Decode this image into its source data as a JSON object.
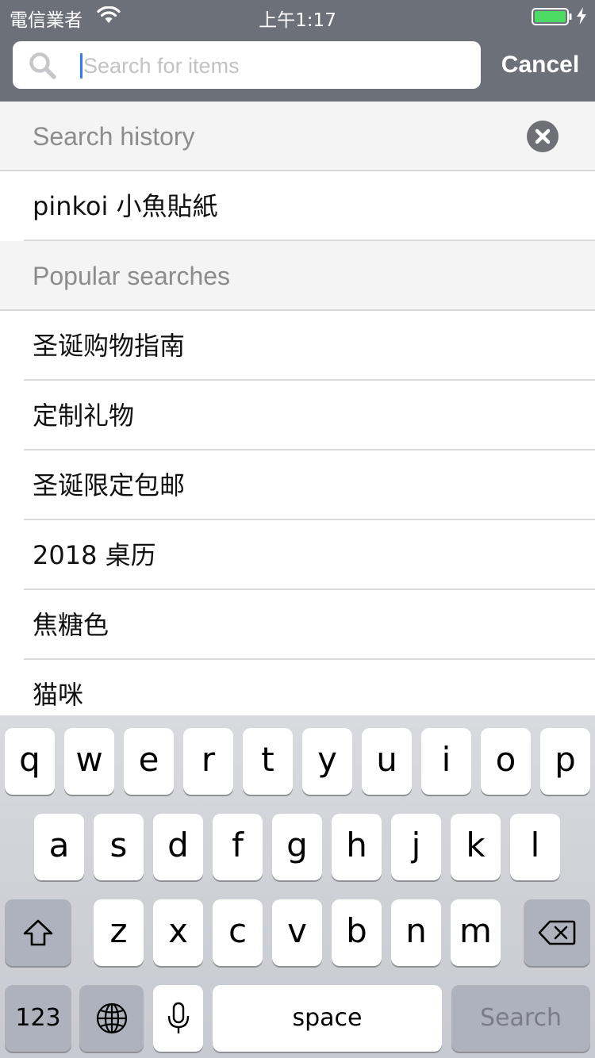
{
  "status_bar": {
    "carrier": "電信業者",
    "time": "上午1:17",
    "icons": [
      "wifi-icon",
      "battery-icon",
      "charging-bolt-icon"
    ],
    "battery_color": "#4cd964"
  },
  "search": {
    "placeholder": "Search for items",
    "value": "",
    "cancel_label": "Cancel",
    "icon": "magnifier-icon"
  },
  "history": {
    "header": "Search history",
    "clear_icon": "clear-x-circle-icon",
    "items": [
      {
        "label": "pinkoi 小魚貼紙"
      }
    ]
  },
  "popular": {
    "header": "Popular searches",
    "items": [
      {
        "label": "圣诞购物指南"
      },
      {
        "label": "定制礼物"
      },
      {
        "label": "圣诞限定包邮"
      },
      {
        "label": "2018 桌历"
      },
      {
        "label": "焦糖色"
      },
      {
        "label": "猫咪"
      }
    ]
  },
  "keyboard": {
    "row1": [
      "q",
      "w",
      "e",
      "r",
      "t",
      "y",
      "u",
      "i",
      "o",
      "p"
    ],
    "row2": [
      "a",
      "s",
      "d",
      "f",
      "g",
      "h",
      "j",
      "k",
      "l"
    ],
    "row3": [
      "z",
      "x",
      "c",
      "v",
      "b",
      "n",
      "m"
    ],
    "numbers_label": "123",
    "space_label": "space",
    "search_label": "Search",
    "icons": [
      "shift-icon",
      "backspace-icon",
      "globe-icon",
      "microphone-icon"
    ]
  },
  "colors": {
    "top_bar": "#6c7079",
    "section_bg": "#f4f4f4",
    "caret": "#3478f6"
  }
}
